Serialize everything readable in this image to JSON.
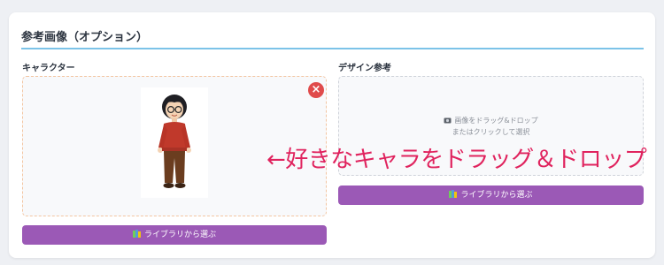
{
  "section": {
    "title": "参考画像（オプション）"
  },
  "character": {
    "label": "キャラクター",
    "remove_icon": "×",
    "library_button": "ライブラリから選ぶ"
  },
  "design": {
    "label": "デザイン参考",
    "hint_line1": "画像をドラッグ&ドロップ",
    "hint_line2": "またはクリックして選択",
    "library_button": "ライブラリから選ぶ"
  },
  "annotation": {
    "text": "←好きなキャラをドラッグ＆ドロップ"
  },
  "colors": {
    "accent_button": "#9b59b6",
    "annotation": "#e0235e",
    "title_rule": "#7cc3e8",
    "remove": "#e04b4b"
  },
  "icons": {
    "library": "books-icon",
    "image": "image-icon",
    "remove": "close-icon"
  }
}
